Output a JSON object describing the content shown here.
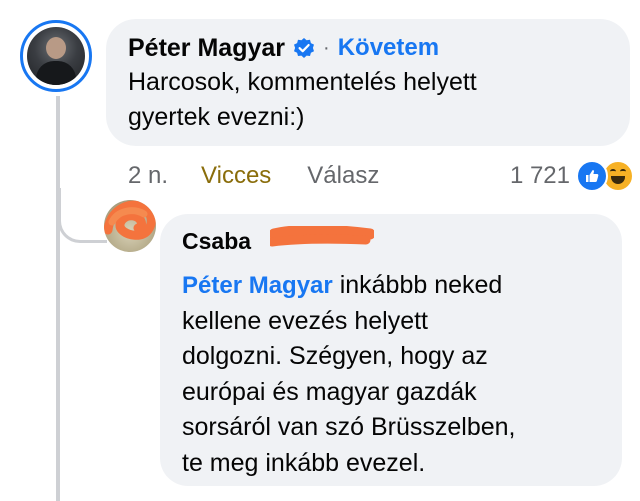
{
  "main_comment": {
    "author": "Péter Magyar",
    "verified_icon": "verified-badge-icon",
    "separator": "·",
    "follow_label": "Követem",
    "text_line1": "Harcosok, kommentelés helyett",
    "text_line2": "gyertek evezni:)"
  },
  "actions": {
    "time": "2 n.",
    "reaction_label": "Vicces",
    "reply_label": "Válasz",
    "reaction_count": "1 721",
    "reaction_icons": [
      "like-icon",
      "haha-icon"
    ]
  },
  "reply_comment": {
    "author": "Csaba",
    "mention": "Péter Magyar",
    "text_line1_rest": " inkábbb neked",
    "text_line2": "kellene evezés helyett",
    "text_line3": "dolgozni. Szégyen, hogy az",
    "text_line4": "európai és magyar gazdák",
    "text_line5": "sorsáról van szó Brüsszelben,",
    "text_line6": "te meg inkább evezel."
  },
  "colors": {
    "accent_blue": "#1877f2",
    "bubble_bg": "#f0f2f5",
    "reacted_gold": "#8a6d0b",
    "redaction_orange": "#f4733d",
    "thread_line": "#ced0d4"
  }
}
